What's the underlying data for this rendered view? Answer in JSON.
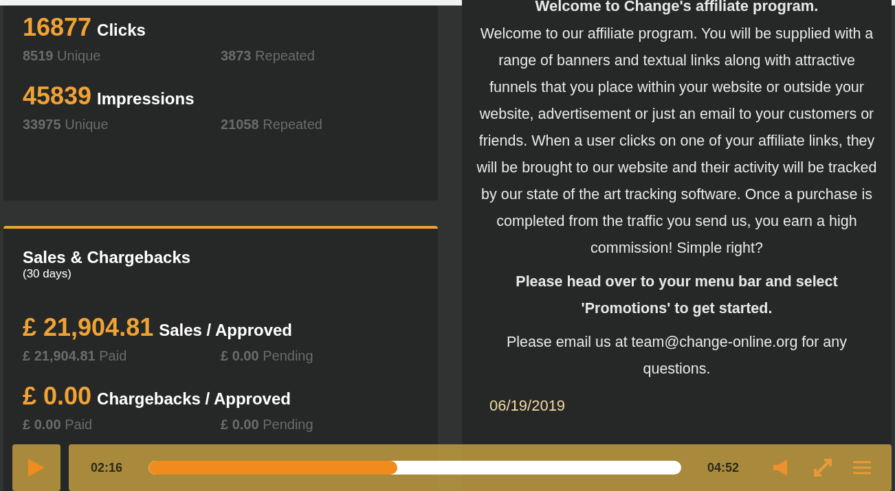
{
  "traffic": {
    "stats": [
      {
        "value": "16877",
        "label": "Clicks",
        "details": [
          {
            "value": "8519",
            "label": "Unique"
          },
          {
            "value": "3873",
            "label": "Repeated"
          }
        ]
      },
      {
        "value": "45839",
        "label": "Impressions",
        "details": [
          {
            "value": "33975",
            "label": "Unique"
          },
          {
            "value": "21058",
            "label": "Repeated"
          }
        ]
      }
    ]
  },
  "sales": {
    "title": "Sales & Chargebacks",
    "subtitle": "(30 days)",
    "stats": [
      {
        "value": "£ 21,904.81",
        "label": "Sales / Approved",
        "details": [
          {
            "value": "£ 21,904.81",
            "label": "Paid"
          },
          {
            "value": "£ 0.00",
            "label": "Pending"
          }
        ]
      },
      {
        "value": "£ 0.00",
        "label": "Chargebacks / Approved",
        "details": [
          {
            "value": "£ 0.00",
            "label": "Paid"
          },
          {
            "value": "£ 0.00",
            "label": "Pending"
          }
        ]
      }
    ]
  },
  "welcome": {
    "title": "Welcome to Change's affiliate program.",
    "paragraphs": [
      {
        "kind": "normal",
        "text": "Welcome to our affiliate program. You will be supplied with a range of banners and textual links along with attractive funnels that you place within your website or outside your website, advertisement or just an email to your customers or friends. When a user clicks on one of your affiliate links, they will be brought to our website and their activity will be tracked by our state of the art tracking software. Once a purchase is completed from the traffic you send us, you earn a high commission! Simple right?"
      },
      {
        "kind": "bold",
        "text": "Please head over to your menu bar and select 'Promotions' to get started."
      },
      {
        "kind": "normal",
        "text": "Please email us at team@change-online.org for any questions."
      }
    ],
    "date": "06/19/2019"
  },
  "player": {
    "current_time": "02:16",
    "duration": "04:52",
    "level": 0.467
  }
}
